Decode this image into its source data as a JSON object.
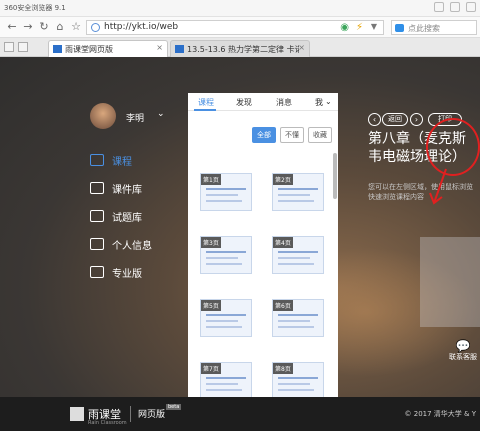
{
  "window": {
    "title": "360安全浏览器 9.1"
  },
  "toolbar": {
    "url": "http://ykt.io/web",
    "search_placeholder": "点此搜索"
  },
  "tabs": [
    {
      "label": "雨课堂网页版",
      "close": "×"
    },
    {
      "label": "13.5-13.6 热力学第二定律 卡诺",
      "close": "×"
    }
  ],
  "sidebar": {
    "username": "李明",
    "items": [
      {
        "label": "课程",
        "icon": "book-icon"
      },
      {
        "label": "课件库",
        "icon": "slides-icon"
      },
      {
        "label": "试题库",
        "icon": "document-icon"
      },
      {
        "label": "个人信息",
        "icon": "person-icon"
      },
      {
        "label": "专业版",
        "icon": "pro-icon"
      }
    ]
  },
  "panel": {
    "tabs": [
      "课程",
      "发现",
      "消息",
      "我"
    ],
    "filters": [
      "全部",
      "不懂",
      "收藏"
    ],
    "slides": [
      "第1页",
      "第2页",
      "第3页",
      "第4页",
      "第5页",
      "第6页",
      "第7页",
      "第8页"
    ]
  },
  "detail": {
    "back_label": "返回",
    "print_label": "打印",
    "chapter_title": "第八章（麦克斯韦电磁场理论）",
    "description": "您可以在左侧区域，使用鼠标浏览快速浏览课程内容"
  },
  "wechat": {
    "label": "联系客服"
  },
  "footer": {
    "logo_text": "雨课堂",
    "logo_sub": "Rain Classroom",
    "web_label": "网页版",
    "beta": "beta",
    "copyright": "© 2017 清华大学 & Y"
  },
  "colors": {
    "accent": "#4a90e2",
    "annotation": "#e02020",
    "footer_bg": "#1d1d1d"
  }
}
